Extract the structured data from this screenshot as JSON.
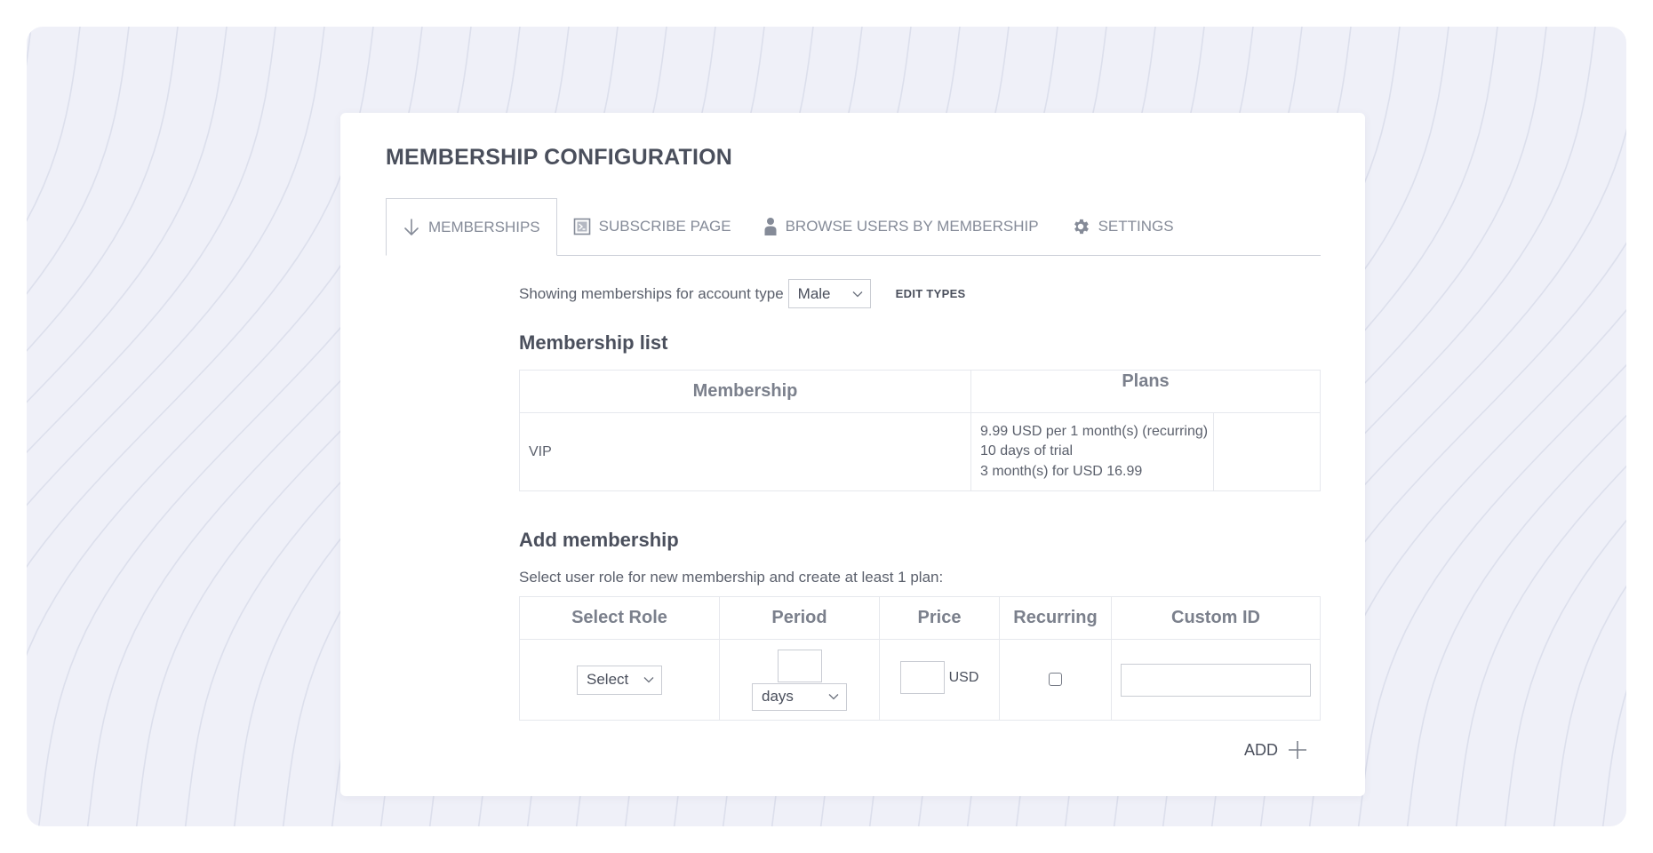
{
  "page_title": "MEMBERSHIP CONFIGURATION",
  "tabs": [
    {
      "label": "MEMBERSHIPS",
      "icon": "arrow-down-icon",
      "active": true
    },
    {
      "label": "SUBSCRIBE PAGE",
      "icon": "subscribe-page-icon",
      "active": false
    },
    {
      "label": "BROWSE USERS BY MEMBERSHIP",
      "icon": "user-icon",
      "active": false
    },
    {
      "label": "SETTINGS",
      "icon": "gear-icon",
      "active": false
    }
  ],
  "account_type": {
    "label": "Showing memberships for account type",
    "selected": "Male",
    "edit_label": "EDIT TYPES"
  },
  "membership_list": {
    "title": "Membership list",
    "headers": [
      "Membership",
      "Plans"
    ],
    "rows": [
      {
        "membership": "VIP",
        "plans": [
          "9.99 USD per 1 month(s) (recurring)",
          "10 days of trial",
          "3 month(s) for USD 16.99"
        ]
      }
    ]
  },
  "add_membership": {
    "title": "Add membership",
    "description": "Select user role for new membership and create at least 1 plan:",
    "headers": [
      "Select Role",
      "Period",
      "Price",
      "Recurring",
      "Custom ID"
    ],
    "role_select": "Select",
    "period_value": "",
    "period_unit": "days",
    "price_value": "",
    "currency": "USD",
    "recurring_checked": false,
    "custom_id_value": "",
    "add_label": "ADD"
  },
  "colors": {
    "background": "#eff0f8",
    "card": "#ffffff",
    "text": "#4a4f5c",
    "muted_text": "#858b98",
    "border": "#e6e8ed"
  }
}
